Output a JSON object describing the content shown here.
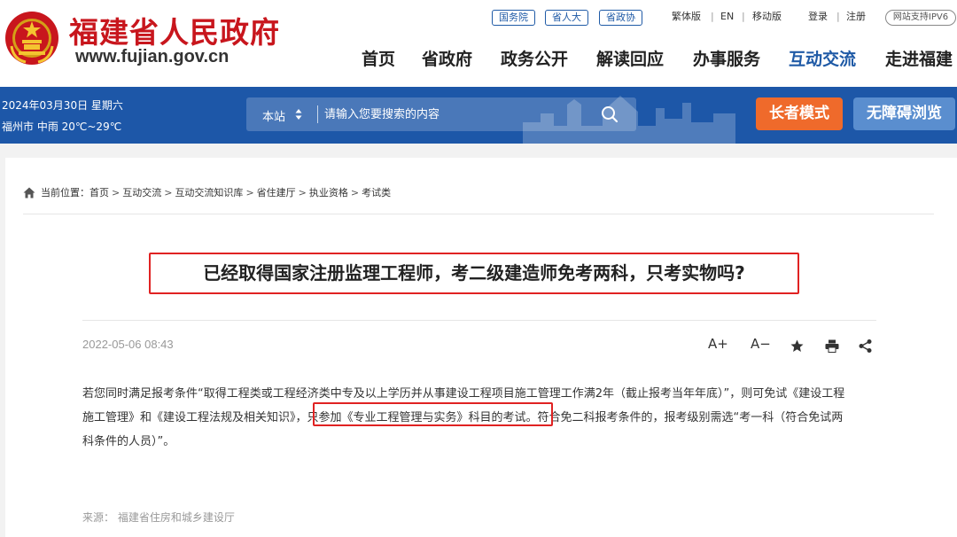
{
  "header": {
    "site_name": "福建省人民政府",
    "domain": "www.fujian.gov.cn",
    "tag_links": [
      "国务院",
      "省人大",
      "省政协"
    ],
    "top_links": {
      "traditional": "繁体版",
      "english": "EN",
      "mobile": "移动版",
      "login": "登录",
      "register": "注册",
      "ipv6": "网站支持IPV6"
    },
    "nav": [
      "首页",
      "省政府",
      "政务公开",
      "解读回应",
      "办事服务",
      "互动交流",
      "走进福建"
    ],
    "active_nav": "互动交流"
  },
  "bluebar": {
    "date": "2024年03月30日  星期六",
    "weather": "福州市  中雨  20℃~29℃",
    "search_scope": "本站",
    "search_placeholder": "请输入您要搜索的内容",
    "elder_mode": "长者模式",
    "accessible": "无障碍浏览"
  },
  "breadcrumb": {
    "label": "当前位置：",
    "items": [
      "首页",
      "互动交流",
      "互动交流知识库",
      "省住建厅",
      "执业资格",
      "考试类"
    ]
  },
  "article": {
    "title": "已经取得国家注册监理工程师，考二级建造师免考两科，只考实物吗?",
    "date": "2022-05-06 08:43",
    "tools": {
      "font_up": "A+",
      "font_down": "A−"
    },
    "body": {
      "line1": "若您同时满足报考条件“取得工程类或工程经济类中专及以上学历并从事建设工程项目施工管理工作满2年（截止报考当年年底）”，则可免试《建设工程",
      "line2_before": "施工管理》和《建设工程法规及相关知识》，",
      "line2_highlight": "只参加《专业工程管理与实务》科目的考试。",
      "line2_after": "符合免二科报考条件的，报考级别需选“考一科（符合免试两",
      "line3": "科条件的人员）”。"
    },
    "source": "来源：  福建省住房和城乡建设厅"
  },
  "colors": {
    "brand_red": "#c8161d",
    "gov_blue": "#1d57a8",
    "nav_active": "#1f5aa6",
    "elder_orange": "#ef6a2b",
    "accessible_blue": "#5a8ecf",
    "annotation_red": "#e02222"
  },
  "icons": [
    "national-emblem-icon",
    "search-icon",
    "home-icon",
    "star-icon",
    "print-icon",
    "share-icon",
    "sort-arrows-icon"
  ]
}
